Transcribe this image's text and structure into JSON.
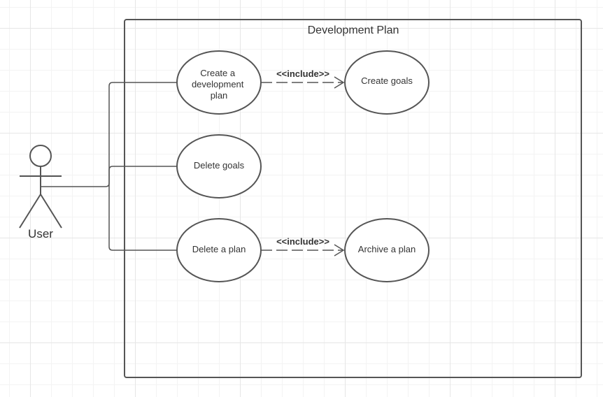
{
  "diagram": {
    "system_title": "Development Plan",
    "actor": {
      "name": "User"
    },
    "use_cases": {
      "create_plan": {
        "lines": [
          "Create a",
          "development",
          "plan"
        ]
      },
      "create_goals": {
        "lines": [
          "Create goals"
        ]
      },
      "delete_goals": {
        "lines": [
          "Delete goals"
        ]
      },
      "delete_plan": {
        "lines": [
          "Delete a plan"
        ]
      },
      "archive_plan": {
        "lines": [
          "Archive a plan"
        ]
      }
    },
    "relations": {
      "include_1": {
        "label": "<<include>>",
        "from": "Create a development plan",
        "to": "Create goals"
      },
      "include_2": {
        "label": "<<include>>",
        "from": "Delete a plan",
        "to": "Archive a plan"
      }
    },
    "colors": {
      "stroke": "#555555",
      "text": "#333333"
    }
  }
}
